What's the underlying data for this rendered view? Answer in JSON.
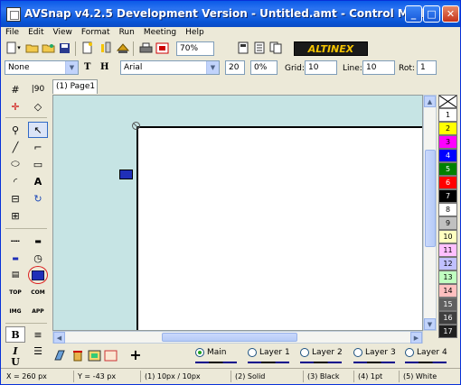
{
  "window": {
    "title": "AVSnap v4.2.5 Development Version - Untitled.amt - Control Mode",
    "controls": [
      "_",
      "□",
      "✕"
    ]
  },
  "menubar": [
    "File",
    "Edit",
    "View",
    "Format",
    "Run",
    "Meeting",
    "Help"
  ],
  "toolbar1": {
    "zoom": "70%",
    "brand": "ALTINEX"
  },
  "toolbar2": {
    "style_select": "None",
    "text_label": "T",
    "height_label": "H",
    "font_select": "Arial",
    "font_size": "20",
    "percent": "0%",
    "grid_label": "Grid:",
    "grid_value": "10",
    "line_label": "Line:",
    "line_value": "10",
    "rot_label": "Rot:",
    "rot_value": "1"
  },
  "tools": {
    "top_label": "TOP",
    "com_label": "COM",
    "img_label": "IMG",
    "app_label": "APP",
    "bold_label": "B",
    "italic_label": "I",
    "underline_label": "U"
  },
  "tab": {
    "label": "(1) Page1"
  },
  "palette": [
    {
      "label": "",
      "color": "#ffffff",
      "text": "#000000"
    },
    {
      "label": "1",
      "color": "#ffffff",
      "text": "#000000"
    },
    {
      "label": "2",
      "color": "#ffff00",
      "text": "#000000"
    },
    {
      "label": "3",
      "color": "#ff00ff",
      "text": "#000000"
    },
    {
      "label": "4",
      "color": "#0000ff",
      "text": "#ffffff"
    },
    {
      "label": "5",
      "color": "#008000",
      "text": "#ffffff"
    },
    {
      "label": "6",
      "color": "#ff0000",
      "text": "#ffffff"
    },
    {
      "label": "7",
      "color": "#000000",
      "text": "#ffffff"
    },
    {
      "label": "8",
      "color": "#ffffff",
      "text": "#000000"
    },
    {
      "label": "9",
      "color": "#c0c0c0",
      "text": "#000000"
    },
    {
      "label": "10",
      "color": "#ffffc0",
      "text": "#000000"
    },
    {
      "label": "11",
      "color": "#ffc0ff",
      "text": "#000000"
    },
    {
      "label": "12",
      "color": "#c0c0ff",
      "text": "#000000"
    },
    {
      "label": "13",
      "color": "#c0ffc0",
      "text": "#000000"
    },
    {
      "label": "14",
      "color": "#ffc0c0",
      "text": "#000000"
    },
    {
      "label": "15",
      "color": "#606060",
      "text": "#ffffff"
    },
    {
      "label": "16",
      "color": "#404040",
      "text": "#ffffff"
    },
    {
      "label": "17",
      "color": "#202020",
      "text": "#ffffff"
    }
  ],
  "layers": {
    "plus": "+",
    "items": [
      {
        "label": "Main",
        "selected": true
      },
      {
        "label": "Layer 1",
        "selected": false
      },
      {
        "label": "Layer 2",
        "selected": false
      },
      {
        "label": "Layer 3",
        "selected": false
      },
      {
        "label": "Layer 4",
        "selected": false
      }
    ]
  },
  "status": {
    "x": "X = 260 px",
    "y": "Y = -43 px",
    "grid": "(1) 10px / 10px",
    "line": "(2) Solid",
    "color": "(3) Black",
    "width": "(4) 1pt",
    "fill": "(5) White"
  }
}
